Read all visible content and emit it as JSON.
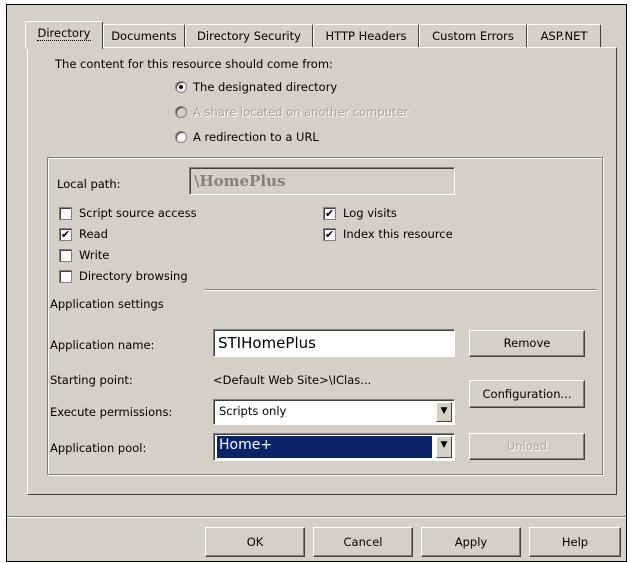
{
  "tabs": [
    {
      "label": "Directory",
      "active": true
    },
    {
      "label": "Documents",
      "active": false
    },
    {
      "label": "Directory Security",
      "active": false
    },
    {
      "label": "HTTP Headers",
      "active": false
    },
    {
      "label": "Custom Errors",
      "active": false
    },
    {
      "label": "ASP.NET",
      "active": false
    }
  ],
  "content_source": {
    "heading": "The content for this resource should come from:",
    "options": [
      {
        "label": "The designated directory",
        "selected": true,
        "enabled": true
      },
      {
        "label": "A share located on another computer",
        "selected": false,
        "enabled": false
      },
      {
        "label": "A redirection to a URL",
        "selected": false,
        "enabled": true
      }
    ]
  },
  "local_path": {
    "label": "Local path:",
    "value": "\\HomePlus"
  },
  "permissions": {
    "script_source_access": {
      "label": "Script source access",
      "checked": false
    },
    "read": {
      "label": "Read",
      "checked": true
    },
    "write": {
      "label": "Write",
      "checked": false
    },
    "directory_browsing": {
      "label": "Directory browsing",
      "checked": false
    },
    "log_visits": {
      "label": "Log visits",
      "checked": true
    },
    "index_resource": {
      "label": "Index this resource",
      "checked": true
    }
  },
  "app_settings": {
    "heading": "Application settings",
    "name_label": "Application name:",
    "name_value": "STIHomePlus",
    "remove_label": "Remove",
    "starting_point_label": "Starting point:",
    "starting_point_value": "<Default Web Site>\\IClas...",
    "configuration_label": "Configuration...",
    "execute_label": "Execute permissions:",
    "execute_value": "Scripts only",
    "pool_label": "Application pool:",
    "pool_value": "Home+",
    "unload_label": "Unload"
  },
  "buttons": {
    "ok": "OK",
    "cancel": "Cancel",
    "apply": "Apply",
    "help": "Help"
  },
  "icons": {
    "check": "✔",
    "dropdown": "▼"
  }
}
